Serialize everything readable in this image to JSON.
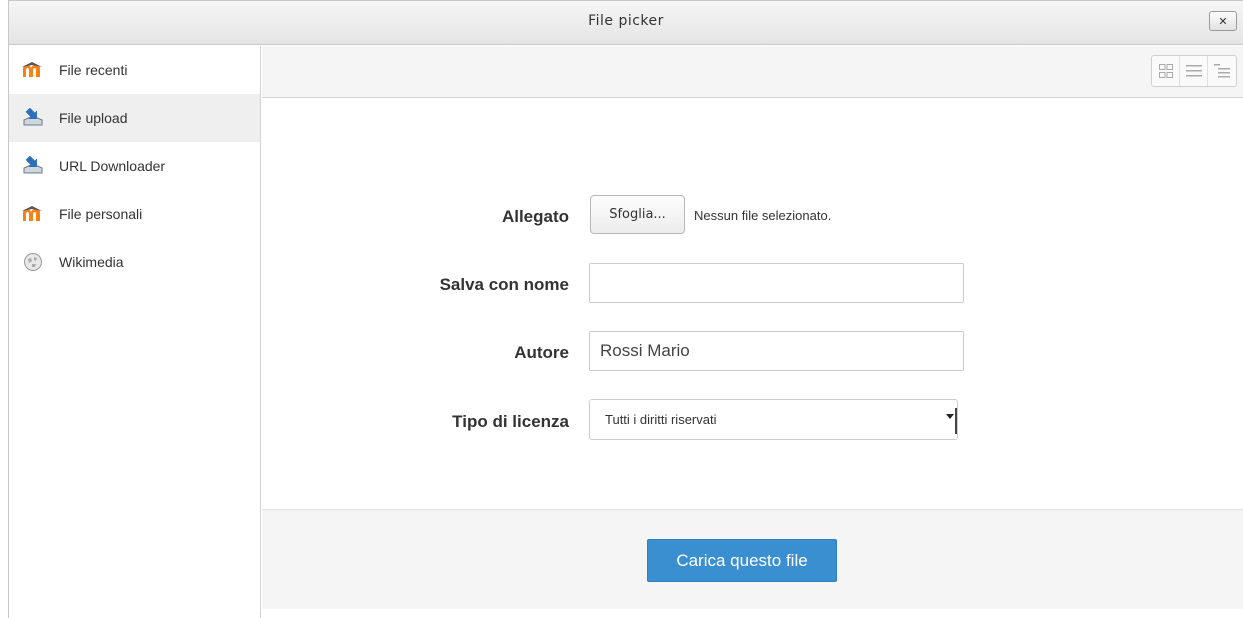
{
  "dialog": {
    "title": "File picker",
    "close_label": "✕"
  },
  "sidebar": {
    "items": [
      {
        "label": "File recenti",
        "icon": "moodle-icon",
        "active": false
      },
      {
        "label": "File upload",
        "icon": "upload-icon",
        "active": true
      },
      {
        "label": "URL Downloader",
        "icon": "download-icon",
        "active": false
      },
      {
        "label": "File personali",
        "icon": "moodle-icon",
        "active": false
      },
      {
        "label": "Wikimedia",
        "icon": "wikimedia-icon",
        "active": false
      }
    ]
  },
  "toolbar": {
    "views": [
      "icons-view-icon",
      "list-view-icon",
      "tree-view-icon"
    ]
  },
  "form": {
    "attachment_label": "Allegato",
    "browse_label": "Sfoglia...",
    "no_file_text": "Nessun file selezionato.",
    "save_as_label": "Salva con nome",
    "save_as_value": "",
    "author_label": "Autore",
    "author_value": "Rossi Mario",
    "license_label": "Tipo di licenza",
    "license_value": "Tutti i diritti riservati"
  },
  "footer": {
    "upload_label": "Carica questo file"
  },
  "colors": {
    "primary_button": "#3a8fd0",
    "moodle_orange": "#f98012"
  }
}
